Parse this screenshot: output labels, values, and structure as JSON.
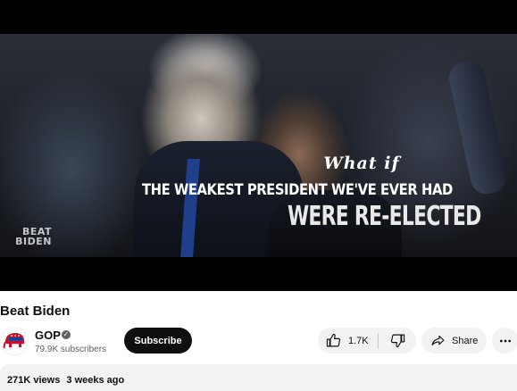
{
  "video": {
    "overlay_line1": "What if",
    "overlay_line2": "THE WEAKEST PRESIDENT WE'VE EVER HAD",
    "overlay_line3": "WERE RE-ELECTED",
    "logo_line1": "BEAT",
    "logo_line2": "BIDEN"
  },
  "title": "Beat Biden",
  "channel": {
    "name": "GOP",
    "subscribers": "79.9K subscribers",
    "verified_icon": "verified-check-icon",
    "avatar_icon": "republican-elephant-icon"
  },
  "actions": {
    "subscribe_label": "Subscribe",
    "like_count": "1.7K",
    "share_label": "Share"
  },
  "description": {
    "views": "271K views",
    "age": "3 weeks ago"
  },
  "colors": {
    "subscribe_bg": "#0f0f0f",
    "chip_bg": "#f2f2f2",
    "gop_red": "#c8102e"
  }
}
